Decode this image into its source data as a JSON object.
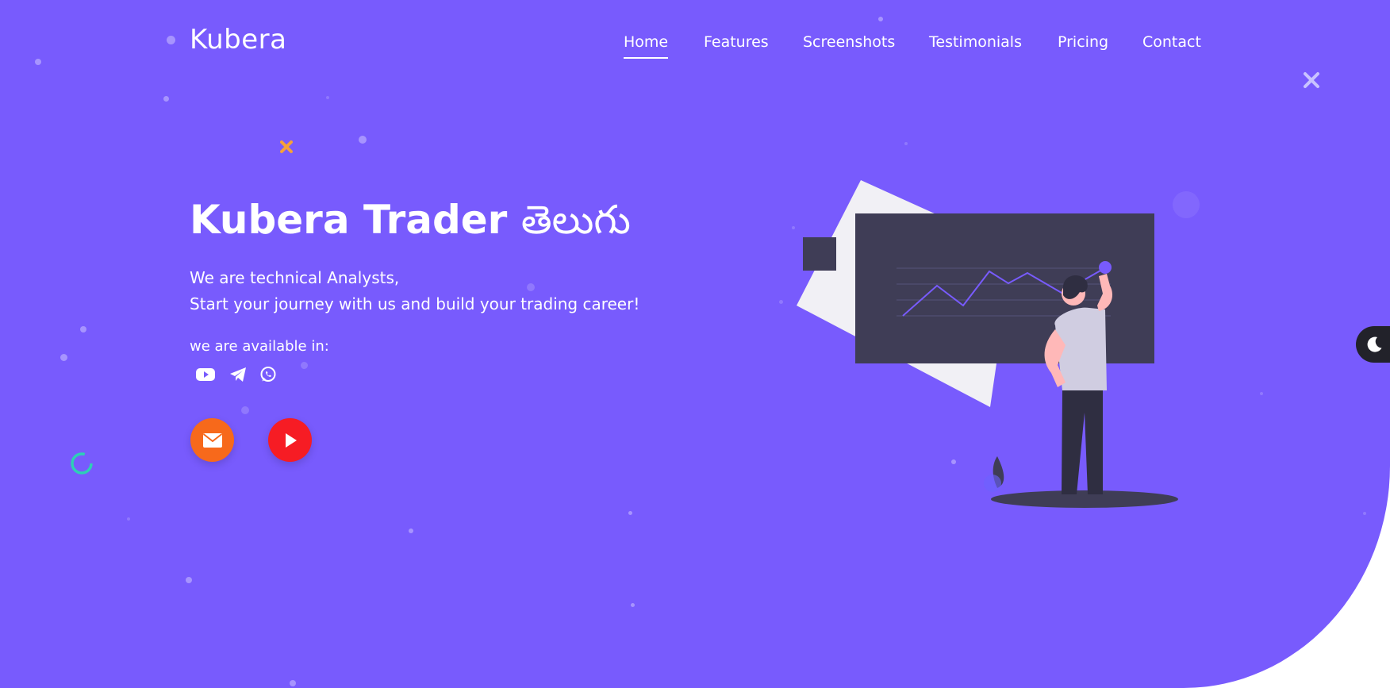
{
  "header": {
    "logo": "Kubera",
    "nav": [
      {
        "label": "Home",
        "active": true
      },
      {
        "label": "Features",
        "active": false
      },
      {
        "label": "Screenshots",
        "active": false
      },
      {
        "label": "Testimonials",
        "active": false
      },
      {
        "label": "Pricing",
        "active": false
      },
      {
        "label": "Contact",
        "active": false
      }
    ]
  },
  "hero": {
    "title_main": "Kubera Trader",
    "title_telugu": "తెలుగు",
    "subtitle_line1": "We are technical Analysts,",
    "subtitle_line2": "Start your journey with us and build your trading career!",
    "available_label": "we are available in:",
    "platforms": [
      "youtube-icon",
      "telegram-icon",
      "whatsapp-icon"
    ],
    "cta_buttons": [
      "email-icon",
      "play-icon"
    ]
  },
  "colors": {
    "background": "#785bfd",
    "email_button": "#f7691b",
    "play_button": "#f61c24",
    "illustration_board": "#3f3d56"
  },
  "icons": {
    "theme_toggle": "moon-icon",
    "decor_close": "close-icon",
    "decor_plus": "plus-icon"
  }
}
